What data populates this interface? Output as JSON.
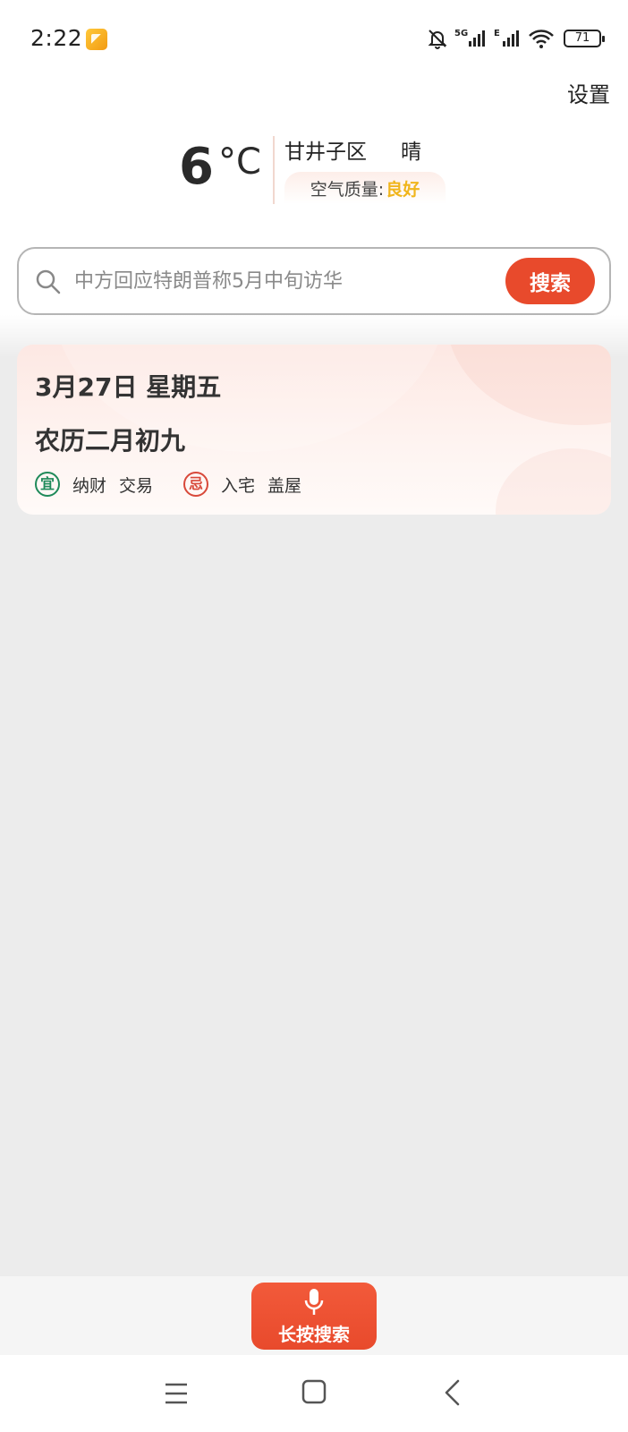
{
  "status_bar": {
    "time": "2:22",
    "network": "5G",
    "network2": "E",
    "battery": "71",
    "icons": [
      "app-notification-icon",
      "bell-muted-icon",
      "signal-icon",
      "wifi-icon",
      "battery-icon"
    ]
  },
  "header": {
    "settings_label": "设置"
  },
  "weather": {
    "temperature": "6",
    "unit": "°C",
    "location": "甘井子区",
    "condition": "晴",
    "aqi_label": "空气质量:",
    "aqi_value": "良好"
  },
  "search": {
    "placeholder": "中方回应特朗普称5月中旬访华",
    "button_label": "搜索"
  },
  "calendar": {
    "date": "3月27日 星期五",
    "lunar": "农历二月初九",
    "good_seal": "宜",
    "good_items": [
      "纳财",
      "交易"
    ],
    "bad_seal": "忌",
    "bad_items": [
      "入宅",
      "盖屋"
    ]
  },
  "voice": {
    "label": "长按搜索"
  },
  "colors": {
    "accent": "#e84a2c",
    "aqi_good": "#f0b51c",
    "good_seal": "#1f8a5a",
    "bad_seal": "#d8493a"
  }
}
